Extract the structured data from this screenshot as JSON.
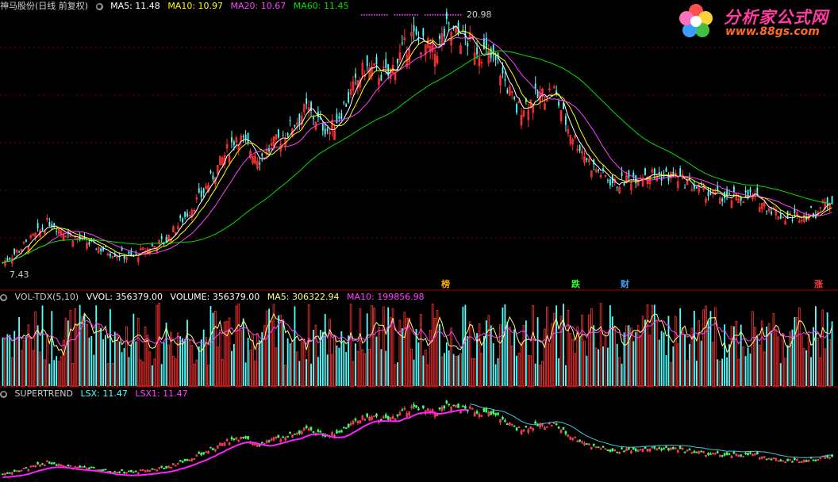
{
  "main_header": {
    "stock_label": "神马股份(日线 前复权)",
    "ma5": "MA5: 11.48",
    "ma10": "MA10: 10.97",
    "ma20": "MA20: 10.67",
    "ma60": "MA60: 11.45"
  },
  "vol_header": {
    "name": "VOL-TDX(5,10)",
    "vvol": "VVOL: 356379.00",
    "volume": "VOLUME: 356379.00",
    "ma5": "MA5: 306322.94",
    "ma10": "MA10: 199856.98"
  },
  "st_header": {
    "name": "SUPERTREND",
    "lsx": "LSX: 11.47",
    "lsx1": "LSX1: 11.47"
  },
  "annotations": {
    "high_price": "20.98",
    "low_price": "7.43"
  },
  "event_markers": [
    {
      "label": "榜",
      "color": "#ffb000"
    },
    {
      "label": "跌",
      "color": "#30ff30"
    },
    {
      "label": "财",
      "color": "#40a0ff"
    },
    {
      "label": "涨",
      "color": "#ff4040"
    }
  ],
  "watermark": {
    "title": "分析家公式网",
    "url": "www.88gs.com"
  },
  "colors": {
    "background": "#000000",
    "up_candle": "#ff3232",
    "down_candle": "#54ffff",
    "ma5": "#ffffff",
    "ma10": "#ffff00",
    "ma20": "#ff40ff",
    "ma60": "#00e000",
    "separator": "#b00000"
  },
  "chart_data": {
    "type": "candlestick",
    "y_range": [
      7.43,
      20.98
    ],
    "anchors": [
      [
        0,
        8.0
      ],
      [
        12,
        9.2
      ],
      [
        20,
        10.2
      ],
      [
        30,
        9.4
      ],
      [
        45,
        8.6
      ],
      [
        55,
        8.3
      ],
      [
        70,
        9.2
      ],
      [
        85,
        11.6
      ],
      [
        100,
        14.8
      ],
      [
        110,
        13.6
      ],
      [
        120,
        14.8
      ],
      [
        130,
        16.2
      ],
      [
        140,
        15.0
      ],
      [
        155,
        18.4
      ],
      [
        165,
        18.0
      ],
      [
        175,
        20.1
      ],
      [
        185,
        19.2
      ],
      [
        190,
        20.5
      ],
      [
        200,
        19.8
      ],
      [
        212,
        18.6
      ],
      [
        220,
        16.2
      ],
      [
        228,
        16.8
      ],
      [
        236,
        17.2
      ],
      [
        242,
        15.2
      ],
      [
        252,
        13.2
      ],
      [
        262,
        12.2
      ],
      [
        275,
        12.8
      ],
      [
        288,
        12.6
      ],
      [
        300,
        11.8
      ],
      [
        310,
        11.4
      ],
      [
        320,
        11.6
      ],
      [
        335,
        10.4
      ],
      [
        348,
        10.7
      ],
      [
        355,
        11.48
      ]
    ],
    "candle_count": 356
  }
}
